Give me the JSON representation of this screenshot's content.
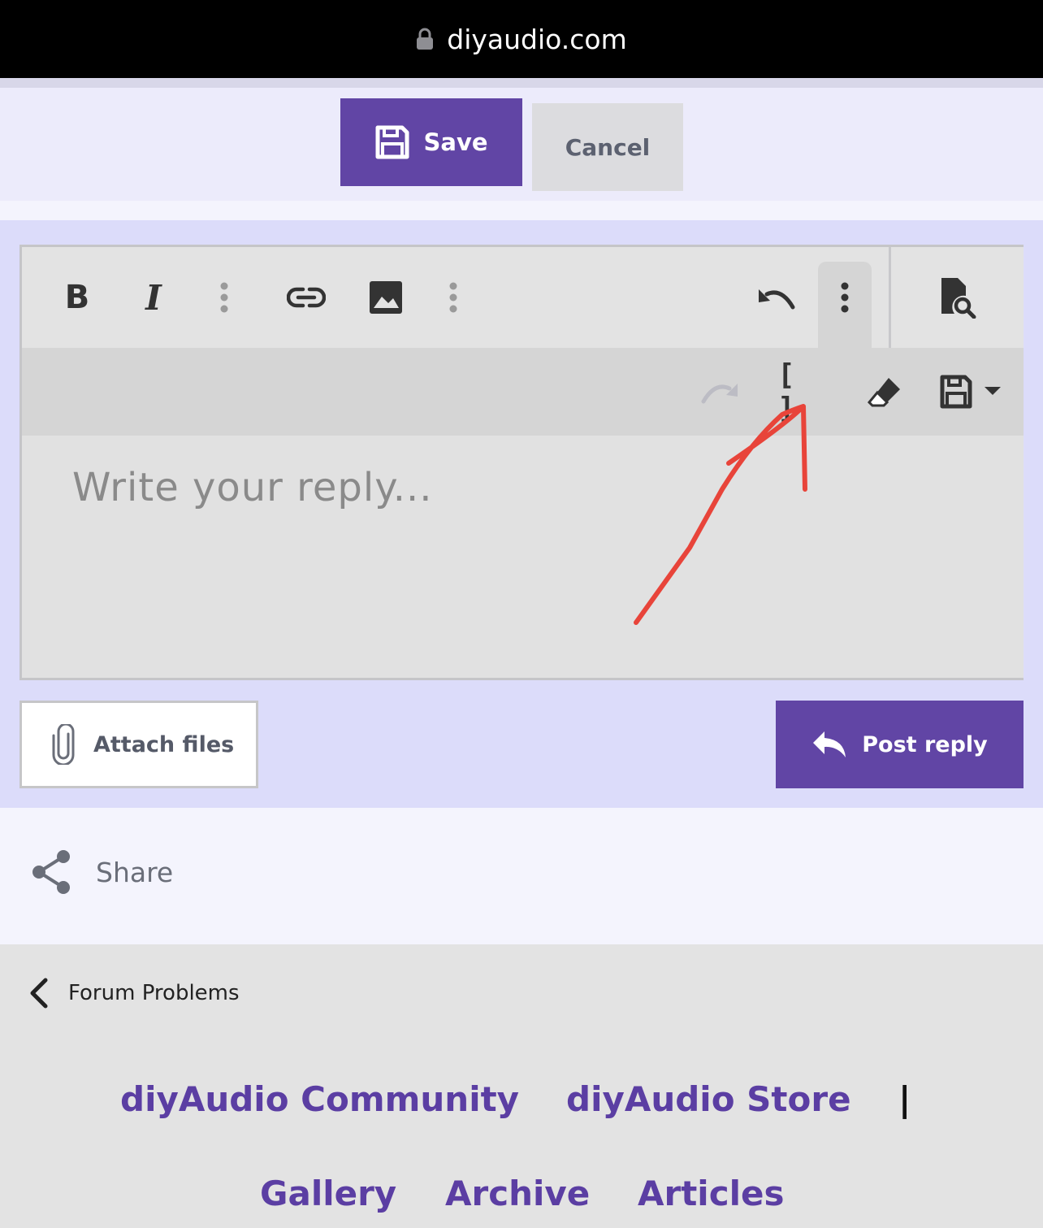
{
  "browser": {
    "url": "diyaudio.com",
    "lock_icon": "lock-icon"
  },
  "edit_bar": {
    "save_label": "Save",
    "cancel_label": "Cancel"
  },
  "toolbar": {
    "items": [
      "bold-icon",
      "italic-icon",
      "more-text-icon",
      "link-icon",
      "image-icon",
      "more-insert-icon",
      "undo-icon",
      "more-options-icon",
      "preview-icon",
      "redo-icon",
      "bbcode-icon",
      "eraser-icon",
      "drafts-icon"
    ],
    "bold_glyph": "B",
    "italic_glyph": "I",
    "bbcode_glyph": "[ ]"
  },
  "editor": {
    "placeholder": "Write your reply..."
  },
  "actions": {
    "attach_label": "Attach files",
    "post_label": "Post reply"
  },
  "share": {
    "label": "Share"
  },
  "breadcrumb": {
    "label": "Forum Problems"
  },
  "footer": {
    "links": [
      "diyAudio Community",
      "diyAudio Store",
      "Gallery",
      "Archive",
      "Articles"
    ],
    "separator": "|"
  },
  "colors": {
    "accent": "#6145a5",
    "annotation": "#e8443a",
    "page_bg": "#dcdcfa"
  }
}
